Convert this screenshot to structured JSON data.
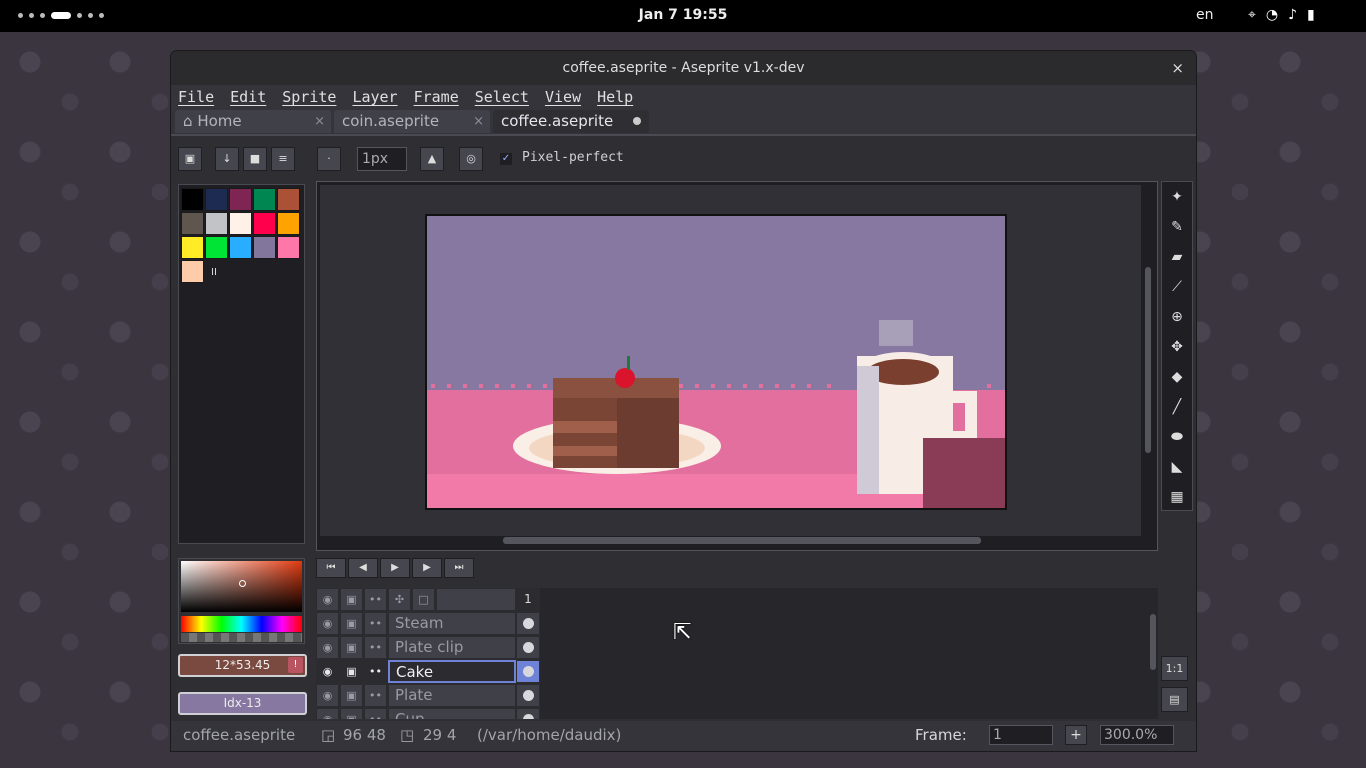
{
  "topbar": {
    "clock": "Jan 7  19:55",
    "lang": "en",
    "icons": [
      "location-icon",
      "wifi-icon",
      "volume-icon",
      "battery-icon"
    ]
  },
  "window": {
    "title": "coffee.aseprite - Aseprite v1.x-dev",
    "close": "×"
  },
  "menu": [
    "File",
    "Edit",
    "Sprite",
    "Layer",
    "Frame",
    "Select",
    "View",
    "Help"
  ],
  "tabs": [
    {
      "label": "Home",
      "icon": "home-icon",
      "close": "×"
    },
    {
      "label": "coin.aseprite",
      "close": "×"
    },
    {
      "label": "coffee.aseprite",
      "modified": true
    }
  ],
  "toolbar": {
    "brush_size": "1px",
    "pixel_perfect_label": "Pixel-perfect",
    "pixel_perfect_checked": true
  },
  "palette": {
    "colors": [
      "#000000",
      "#1d2b53",
      "#7e2553",
      "#008751",
      "#ab5236",
      "#5f574f",
      "#c2c3c7",
      "#fff1e8",
      "#ff004d",
      "#ffa300",
      "#ffec27",
      "#00e436",
      "#29adff",
      "#83769c",
      "#ff77a8",
      "#ffccaa"
    ],
    "more_label": "II"
  },
  "colorbar": {
    "fg_label": "12*53.45",
    "bg_label": "Idx-13",
    "fg_color": "#7a4a41",
    "bg_color": "#8678a0"
  },
  "timeline": {
    "frame_header": "1",
    "layers": [
      {
        "name": "Steam",
        "selected": false
      },
      {
        "name": "Plate clip",
        "selected": false
      },
      {
        "name": "Cake",
        "selected": true
      },
      {
        "name": "Plate",
        "selected": false
      },
      {
        "name": "Cup",
        "selected": false
      }
    ]
  },
  "status": {
    "filename": "coffee.aseprite",
    "pos": "96 48",
    "size": "29 4",
    "path": "(/var/home/daudix)",
    "frame_label": "Frame:",
    "frame_value": "1",
    "plus": "+",
    "zoom": "300.0%"
  },
  "side_buttons": {
    "one_to_one": "1:1"
  }
}
